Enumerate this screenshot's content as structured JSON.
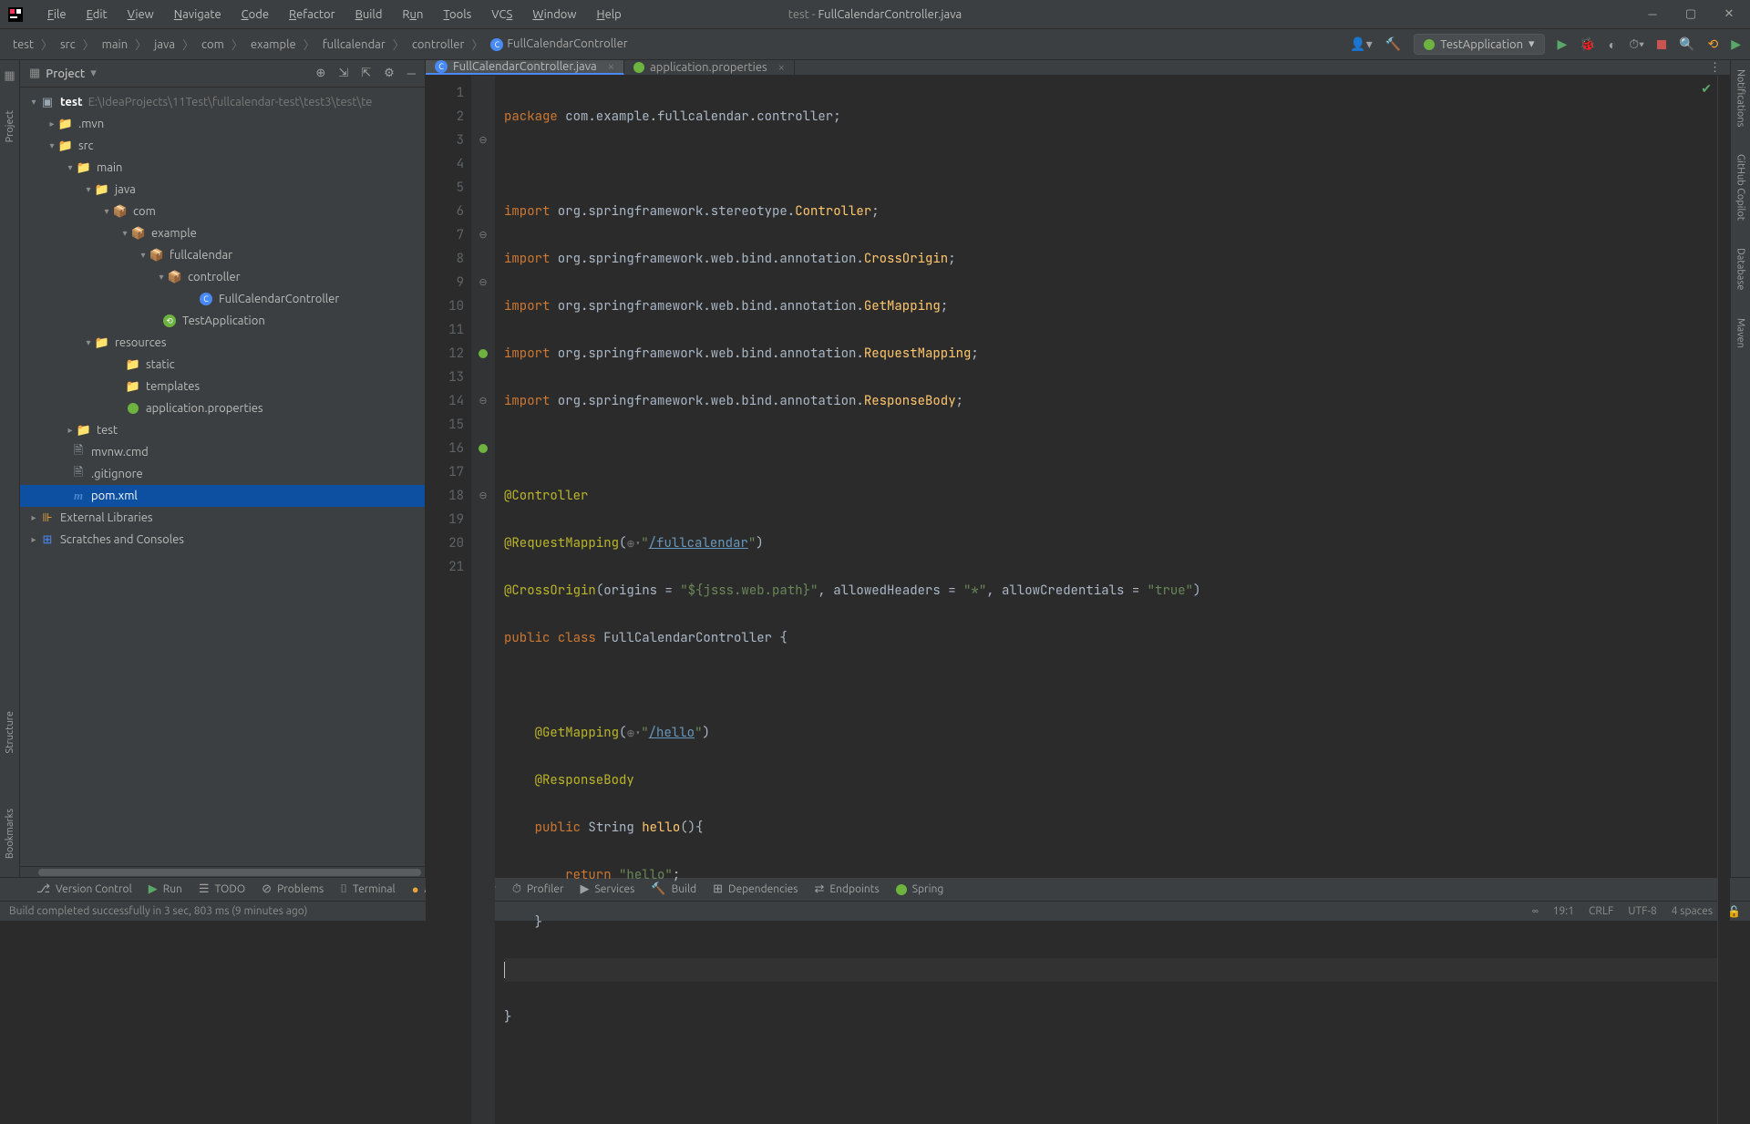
{
  "window": {
    "title_proj": "test",
    "title_file": "FullCalendarController.java"
  },
  "menus": [
    "File",
    "Edit",
    "View",
    "Navigate",
    "Code",
    "Refactor",
    "Build",
    "Run",
    "Tools",
    "VCS",
    "Window",
    "Help"
  ],
  "breadcrumb": [
    "test",
    "src",
    "main",
    "java",
    "com",
    "example",
    "fullcalendar",
    "controller",
    "FullCalendarController"
  ],
  "run_config": "TestApplication",
  "project_panel": {
    "title": "Project"
  },
  "tree": {
    "root": {
      "name": "test",
      "path": "E:\\IdeaProjects\\11Test\\fullcalendar-test\\test3\\test\\te"
    },
    "mvn": ".mvn",
    "src": "src",
    "main": "main",
    "java": "java",
    "com": "com",
    "example": "example",
    "fullcalendar": "fullcalendar",
    "controller": "controller",
    "fcc": "FullCalendarController",
    "testapp": "TestApplication",
    "resources": "resources",
    "static": "static",
    "templates": "templates",
    "appprops": "application.properties",
    "test": "test",
    "mvnw": "mvnw.cmd",
    "gitignore": ".gitignore",
    "pom": "pom.xml",
    "extlib": "External Libraries",
    "scratch": "Scratches and Consoles"
  },
  "tabs": {
    "active": "FullCalendarController.java",
    "other": "application.properties"
  },
  "code": {
    "l1": {
      "kw": "package",
      "rest": " com.example.fullcalendar.controller;"
    },
    "l3": {
      "kw": "import",
      "pre": " org.springframework.stereotype.",
      "cls": "Controller",
      "post": ";"
    },
    "l4": {
      "kw": "import",
      "pre": " org.springframework.web.bind.annotation.",
      "cls": "CrossOrigin",
      "post": ";"
    },
    "l5": {
      "kw": "import",
      "pre": " org.springframework.web.bind.annotation.",
      "cls": "GetMapping",
      "post": ";"
    },
    "l6": {
      "kw": "import",
      "pre": " org.springframework.web.bind.annotation.",
      "cls": "RequestMapping",
      "post": ";"
    },
    "l7": {
      "kw": "import",
      "pre": " org.springframework.web.bind.annotation.",
      "cls": "ResponseBody",
      "post": ";"
    },
    "l9": "@Controller",
    "l10": {
      "ann": "@RequestMapping",
      "open": "(",
      "icon": "⊕▾",
      "str": "\"",
      "link": "/fullcalendar",
      "strend": "\"",
      "close": ")"
    },
    "l11": {
      "ann": "@CrossOrigin",
      "text": "(origins = ",
      "s1": "\"${jsss.web.path}\"",
      "m": ", allowedHeaders = ",
      "s2": "\"*\"",
      "m2": ", allowCredentials = ",
      "s3": "\"true\"",
      "close": ")"
    },
    "l12": {
      "kw1": "public ",
      "kw2": "class ",
      "name": "FullCalendarController ",
      "brace": "{"
    },
    "l14": {
      "ind": "    ",
      "ann": "@GetMapping",
      "open": "(",
      "icon": "⊕▾",
      "str": "\"",
      "link": "/hello",
      "strend": "\"",
      "close": ")"
    },
    "l15": {
      "ind": "    ",
      "ann": "@ResponseBody"
    },
    "l16": {
      "ind": "    ",
      "kw": "public ",
      "type": "String ",
      "name": "hello",
      "sig": "(){"
    },
    "l17": {
      "ind": "        ",
      "kw": "return ",
      "str": "\"hello\"",
      "semi": ";"
    },
    "l18": "    }",
    "l20": "}"
  },
  "line_numbers": [
    "1",
    "2",
    "3",
    "4",
    "5",
    "6",
    "7",
    "8",
    "9",
    "10",
    "11",
    "12",
    "13",
    "14",
    "15",
    "16",
    "17",
    "18",
    "19",
    "20",
    "21"
  ],
  "toolbar": {
    "vc": "Version Control",
    "run": "Run",
    "todo": "TODO",
    "problems": "Problems",
    "terminal": "Terminal",
    "applet": "Applet Runner",
    "profiler": "Profiler",
    "services": "Services",
    "build": "Build",
    "deps": "Dependencies",
    "endpoints": "Endpoints",
    "spring": "Spring"
  },
  "status": {
    "msg": "Build completed successfully in 3 sec, 803 ms (9 minutes ago)",
    "pos": "19:1",
    "eol": "CRLF",
    "enc": "UTF-8",
    "indent": "4 spaces"
  },
  "right_tools": [
    "Notifications",
    "GitHub Copilot",
    "Database",
    "Maven"
  ],
  "left_tools": [
    "Project",
    "Structure",
    "Bookmarks"
  ]
}
